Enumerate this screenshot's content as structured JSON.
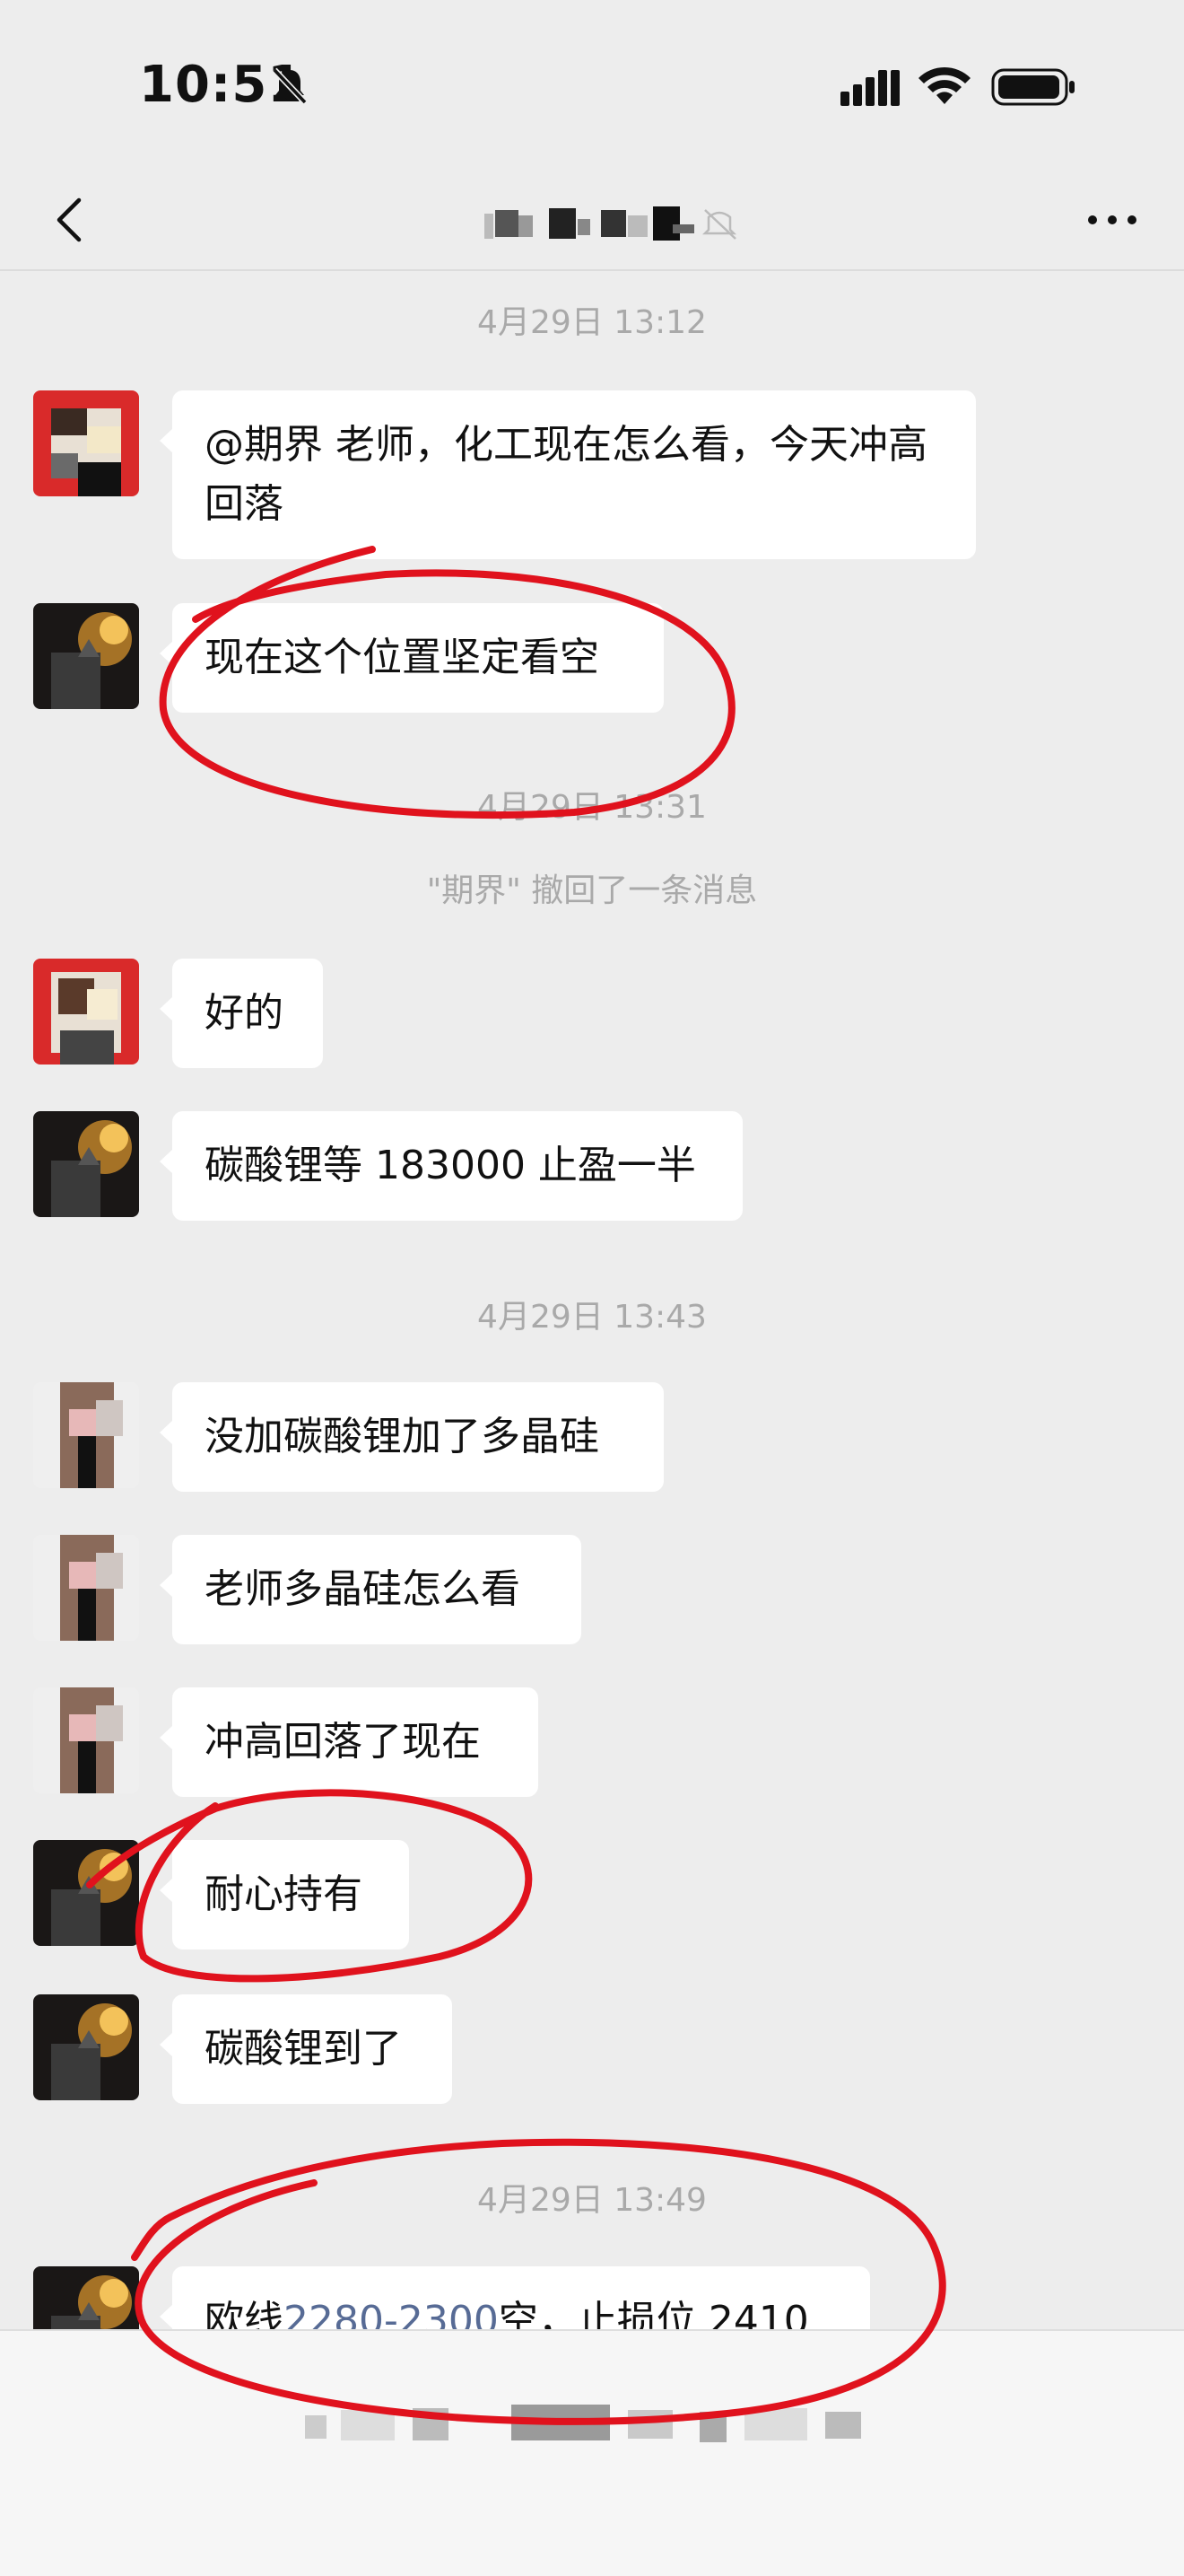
{
  "status_bar": {
    "time": "10:51",
    "icons": [
      "bell-slash-icon",
      "cellular-signal-icon",
      "wifi-icon",
      "battery-icon"
    ]
  },
  "nav": {
    "title_obscured": true,
    "icons": [
      "back-chevron-icon",
      "more-dots-icon",
      "mute-icon"
    ]
  },
  "colors": {
    "background": "#ededed",
    "bubble": "#ffffff",
    "timestamp": "#a9a9a9",
    "link": "#576b95",
    "annotation_red": "#e0121d"
  },
  "messages": {
    "ts1": "4月29日 13:12",
    "m1_text": "@期界 老师，化工现在怎么看，今天冲高回落",
    "m2_text": "现在这个位置坚定看空",
    "ts2": "4月29日 13:31",
    "recall_notice": "\"期界\" 撤回了一条消息",
    "m3_text": "好的",
    "m4_text": "碳酸锂等 183000 止盈一半",
    "ts3": "4月29日 13:43",
    "m5_text": "没加碳酸锂加了多晶硅",
    "m6_text": "老师多晶硅怎么看",
    "m7_text": "冲高回落了现在",
    "m8_text": "耐心持有",
    "m9_text": "碳酸锂到了",
    "ts4": "4月29日 13:49",
    "m10_prefix": "欧线",
    "m10_link": "2280-2300",
    "m10_suffix": "空，止损位 2410"
  },
  "input_bar": {
    "obscured": true
  }
}
